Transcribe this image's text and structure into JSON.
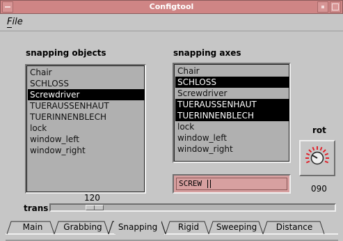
{
  "window": {
    "title": "Configtool"
  },
  "menu": {
    "file_label": "File"
  },
  "snapping_objects": {
    "label": "snapping objects",
    "items": [
      "Chair",
      "SCHLOSS",
      "Screwdriver",
      "TUERAUSSENHAUT",
      "TUERINNENBLECH",
      "lock",
      "window_left",
      "window_right"
    ],
    "selected": [
      2
    ]
  },
  "snapping_axes": {
    "label": "snapping axes",
    "items": [
      "Chair",
      "SCHLOSS",
      "Screwdriver",
      "TUERAUSSENHAUT",
      "TUERINNENBLECH",
      "lock",
      "window_left",
      "window_right"
    ],
    "selected": [
      1,
      3,
      4
    ]
  },
  "rot": {
    "label": "rot",
    "value": "090"
  },
  "text_input": {
    "value": "SCREW"
  },
  "trans": {
    "label": "trans",
    "value": "120",
    "position_fraction": 0.13
  },
  "tabs": [
    {
      "label": "Main"
    },
    {
      "label": "Grabbing"
    },
    {
      "label": "Snapping",
      "active": true
    },
    {
      "label": "Rigid"
    },
    {
      "label": "Sweeping"
    },
    {
      "label": "Distance"
    }
  ],
  "colors": {
    "titlebar": "#cf8585",
    "accent_field": "#d7a0a0",
    "panel": "#c6c6c6",
    "list_bg": "#b0b0b0",
    "knob_ticks": "#e0202a"
  }
}
